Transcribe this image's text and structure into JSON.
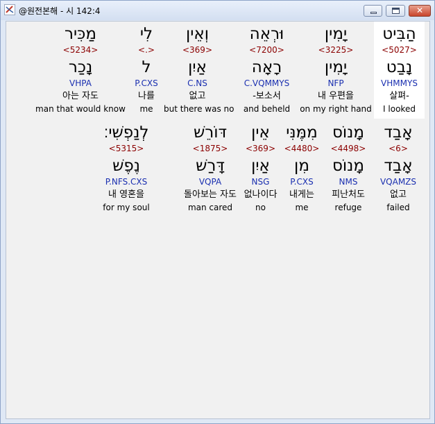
{
  "window": {
    "title": "@원전본해 - 시 142:4",
    "buttons": {
      "minimize_icon": "minimize-icon",
      "maximize_icon": "maximize-icon",
      "close_symbol": "✕"
    }
  },
  "rows": [
    {
      "words": [
        {
          "hebrew": "הַבִּיט",
          "strong": "<5027>",
          "lemma": "נָבַט",
          "parse": "VHMMYS",
          "korean": "살펴-",
          "english": "I looked",
          "selected": true
        },
        {
          "hebrew": "יָמִין",
          "strong": "<3225>",
          "lemma": "יָמִין",
          "parse": "NFP",
          "korean": "내 우편을",
          "english": "on my right hand"
        },
        {
          "hebrew": "וּרְאֵה",
          "strong": "<7200>",
          "lemma": "רָאָה",
          "parse": "C.VQMMYS",
          "korean": "-보소서",
          "english": "and beheld"
        },
        {
          "hebrew": "וְאֵין",
          "strong": "<369>",
          "lemma": "אַיִן",
          "parse": "C.NS",
          "korean": "없고",
          "english": "but there was no"
        },
        {
          "hebrew": "לִי",
          "strong": "<.>",
          "lemma": "ל",
          "parse": "P.CXS",
          "korean": "나를",
          "english": "me"
        },
        {
          "hebrew": "מַכִּיר",
          "strong": "<5234>",
          "lemma": "נָכַר",
          "parse": "VHPA",
          "korean": "아는 자도",
          "english": "man that would know"
        }
      ]
    },
    {
      "words": [
        {
          "hebrew": "אָבַד",
          "strong": "<6>",
          "lemma": "אָבַד",
          "parse": "VQAMZS",
          "korean": "없고",
          "english": "failed"
        },
        {
          "hebrew": "מָנוֹס",
          "strong": "<4498>",
          "lemma": "מָנוֹס",
          "parse": "NMS",
          "korean": "피난처도",
          "english": "refuge"
        },
        {
          "hebrew": "מִמֶּנִּי",
          "strong": "<4480>",
          "lemma": "מִן",
          "parse": "P.CXS",
          "korean": "내게는",
          "english": "me"
        },
        {
          "hebrew": "אֵין",
          "strong": "<369>",
          "lemma": "אַיִן",
          "parse": "NSG",
          "korean": "없나이다",
          "english": "no"
        },
        {
          "hebrew": "דּוֹרֵשׁ",
          "strong": "<1875>",
          "lemma": "דָּרַשׁ",
          "parse": "VQPA",
          "korean": "돌아보는 자도",
          "english": "man cared"
        },
        {
          "hebrew": "לְנַפְשִׁי׃",
          "strong": "<5315>",
          "lemma": "נֶפֶשׁ",
          "parse": "P.NFS.CXS",
          "korean": "내 영혼을",
          "english": "for my soul"
        }
      ]
    }
  ]
}
